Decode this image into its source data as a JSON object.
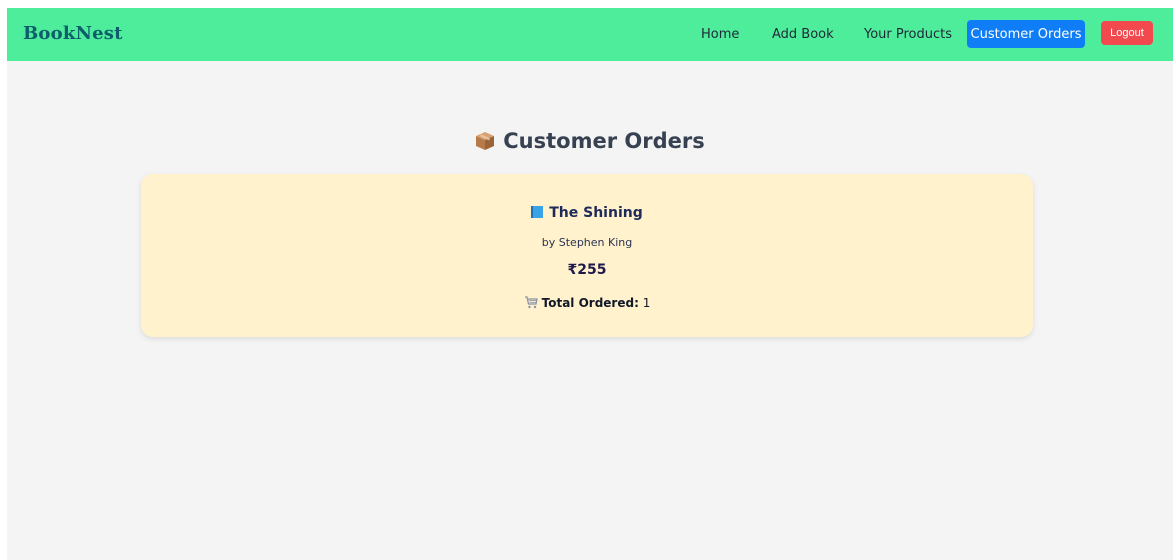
{
  "navbar": {
    "brand": "BookNest",
    "links": [
      "Home",
      "Add Book",
      "Your Products"
    ],
    "active_link": "Customer Orders",
    "logout_label": "Logout",
    "bg_color": "#4eed9b",
    "active_color": "#0f7ef6",
    "logout_color": "#f2494f"
  },
  "main": {
    "heading": "Customer Orders",
    "heading_icon": "package-icon"
  },
  "orders": [
    {
      "title": "The Shining",
      "title_icon": "book-icon",
      "author": "by Stephen King",
      "price": "₹255",
      "total_label": "Total Ordered:",
      "total_value": "1",
      "total_icon": "cart-icon"
    }
  ]
}
